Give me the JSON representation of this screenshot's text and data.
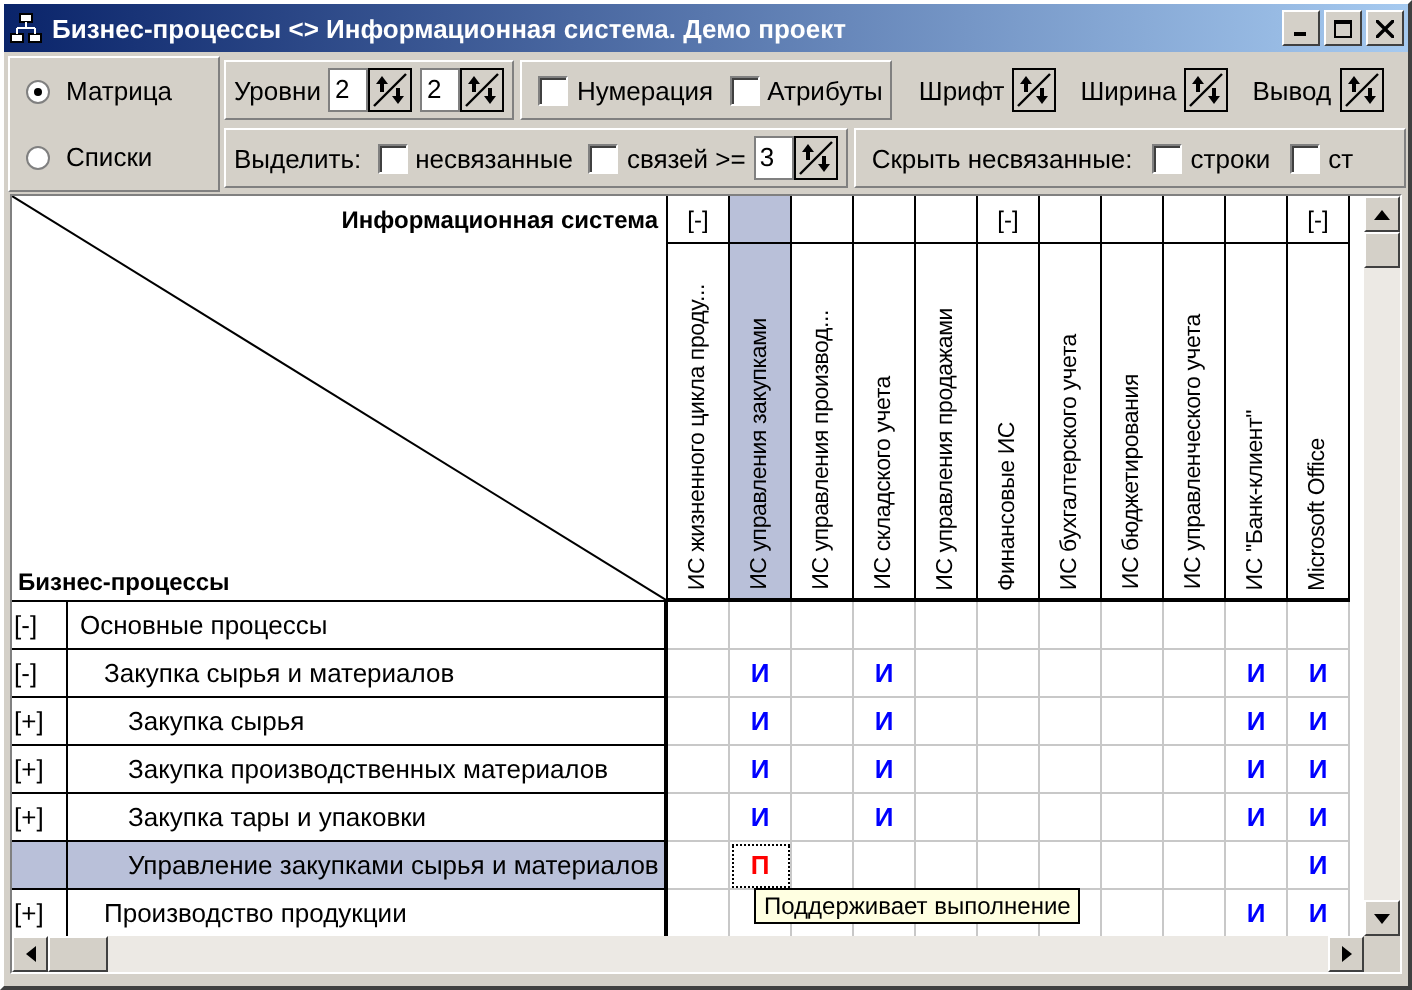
{
  "window": {
    "title": "Бизнес-процессы <> Информационная система. Демо проект"
  },
  "view_modes": [
    {
      "label": "Матрица",
      "selected": true
    },
    {
      "label": "Списки",
      "selected": false
    }
  ],
  "toolbar": {
    "levels": {
      "label": "Уровни",
      "values": [
        "2",
        "2"
      ]
    },
    "options": [
      {
        "label": "Нумерация",
        "checked": false
      },
      {
        "label": "Атрибуты",
        "checked": false
      }
    ],
    "adjusters": [
      "Шрифт",
      "Ширина",
      "Вывод"
    ],
    "highlight": {
      "label": "Выделить:",
      "unlinked": {
        "label": "несвязанные",
        "checked": false
      },
      "links": {
        "label": "связей >=",
        "checked": false,
        "value": "3"
      }
    },
    "hide": {
      "label": "Скрыть несвязанные:",
      "options": [
        {
          "label": "строки",
          "checked": false
        },
        {
          "label": "ст",
          "checked": false
        }
      ]
    }
  },
  "matrix": {
    "columns_title": "Информационная система",
    "rows_title": "Бизнес-процессы",
    "columns": [
      {
        "label": "ИС жизненного цикла проду...",
        "toggle": "[-]",
        "selected": false
      },
      {
        "label": "ИС управления закупками",
        "selected": true
      },
      {
        "label": "ИС управления производ...",
        "selected": false
      },
      {
        "label": "ИС складского учета",
        "selected": false
      },
      {
        "label": "ИС управления продажами",
        "selected": false
      },
      {
        "label": "Финансовые ИС",
        "toggle": "[-]",
        "selected": false
      },
      {
        "label": "ИС бухгалтерского учета",
        "selected": false
      },
      {
        "label": "ИС бюджетирования",
        "selected": false
      },
      {
        "label": "ИС управленческого учета",
        "selected": false
      },
      {
        "label": "ИС \"Банк-клиент\"",
        "selected": false
      },
      {
        "label": "Microsoft Office",
        "toggle": "[-]",
        "selected": false
      }
    ],
    "rows": [
      {
        "toggle": "[-]",
        "label": "Основные процессы",
        "selected": false,
        "cells": [
          null,
          null,
          null,
          null,
          null,
          null,
          null,
          null,
          null,
          null,
          null
        ],
        "children": [
          {
            "toggle": "[-]",
            "label": "Закупка сырья и материалов",
            "selected": false,
            "cells": [
              null,
              {
                "text": "И",
                "kind": "uses"
              },
              null,
              {
                "text": "И",
                "kind": "uses"
              },
              null,
              null,
              null,
              null,
              null,
              {
                "text": "И",
                "kind": "uses"
              },
              {
                "text": "И",
                "kind": "uses"
              }
            ],
            "children": [
              {
                "toggle": "[+]",
                "label": "Закупка сырья",
                "selected": false,
                "cells": [
                  null,
                  {
                    "text": "И",
                    "kind": "uses"
                  },
                  null,
                  {
                    "text": "И",
                    "kind": "uses"
                  },
                  null,
                  null,
                  null,
                  null,
                  null,
                  {
                    "text": "И",
                    "kind": "uses"
                  },
                  {
                    "text": "И",
                    "kind": "uses"
                  }
                ]
              },
              {
                "toggle": "[+]",
                "label": "Закупка производственных материалов",
                "selected": false,
                "cells": [
                  null,
                  {
                    "text": "И",
                    "kind": "uses"
                  },
                  null,
                  {
                    "text": "И",
                    "kind": "uses"
                  },
                  null,
                  null,
                  null,
                  null,
                  null,
                  {
                    "text": "И",
                    "kind": "uses"
                  },
                  {
                    "text": "И",
                    "kind": "uses"
                  }
                ]
              },
              {
                "toggle": "[+]",
                "label": "Закупка тары и упаковки",
                "selected": false,
                "cells": [
                  null,
                  {
                    "text": "И",
                    "kind": "uses"
                  },
                  null,
                  {
                    "text": "И",
                    "kind": "uses"
                  },
                  null,
                  null,
                  null,
                  null,
                  null,
                  {
                    "text": "И",
                    "kind": "uses"
                  },
                  {
                    "text": "И",
                    "kind": "uses"
                  }
                ]
              },
              {
                "label": "Управление закупками сырья и материалов",
                "selected": true,
                "cells": [
                  null,
                  {
                    "text": "П",
                    "kind": "supports",
                    "focused": true
                  },
                  null,
                  null,
                  null,
                  null,
                  null,
                  null,
                  null,
                  null,
                  {
                    "text": "И",
                    "kind": "uses"
                  }
                ]
              }
            ]
          },
          {
            "toggle": "[+]",
            "label": "Производство продукции",
            "selected": false,
            "cells": [
              null,
              null,
              null,
              null,
              null,
              null,
              null,
              null,
              null,
              {
                "text": "И",
                "kind": "uses"
              },
              {
                "text": "И",
                "kind": "uses"
              }
            ]
          }
        ]
      }
    ],
    "tooltip": "Поддерживает выполнение"
  }
}
